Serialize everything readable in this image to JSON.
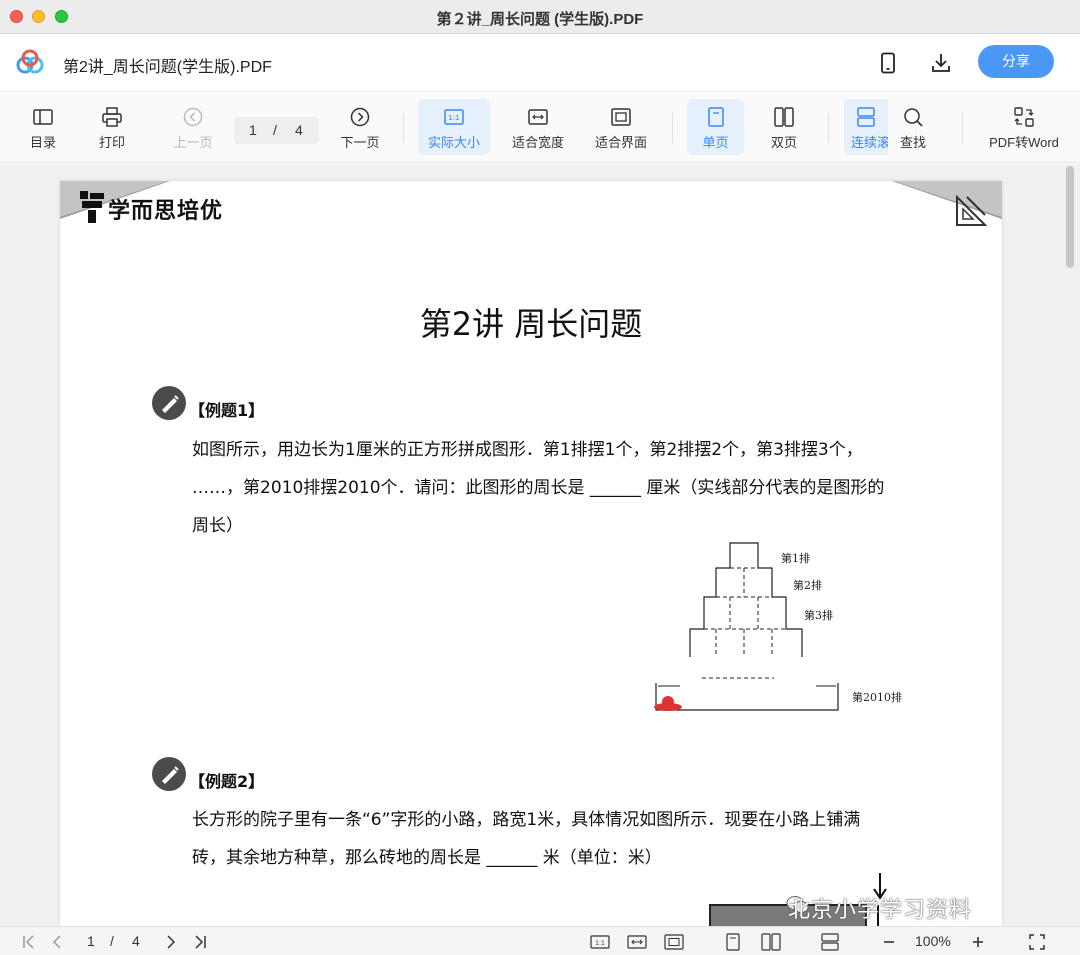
{
  "window": {
    "title": "第２讲_周长问题 (学生版).PDF"
  },
  "header": {
    "doc_name": "第2讲_周长问题(学生版).PDF",
    "share_label": "分享"
  },
  "toolbar": {
    "toc": "目录",
    "print": "打印",
    "prev": "上一页",
    "page_current": "1",
    "page_sep": "/",
    "page_total": "4",
    "next": "下一页",
    "actual_size": "实际大小",
    "fit_width": "适合宽度",
    "fit_page": "适合界面",
    "single": "单页",
    "double": "双页",
    "continuous": "连续滚",
    "find": "查找",
    "to_word": "PDF转Word"
  },
  "document": {
    "brand": "学而思培优",
    "title": "第2讲 周长问题",
    "example1": {
      "label": "【例题1】",
      "line1": "如图所示，用边长为1厘米的正方形拼成图形．第1排摆1个，第2排摆2个，第3排摆3个，",
      "line2": "……，第2010排摆2010个．请问：此图形的周长是 ______ 厘米（实线部分代表的是图形的",
      "line3": "周长）",
      "row1": "第1排",
      "row2": "第2排",
      "row3": "第3排",
      "row2010": "第2010排"
    },
    "example2": {
      "label": "【例题2】",
      "line1": "长方形的院子里有一条“6”字形的小路，路宽1米，具体情况如图所示．现要在小路上铺满",
      "line2": "砖，其余地方种草，那么砖地的周长是 ______ 米（单位：米）"
    },
    "watermark": "北京小学学习资料"
  },
  "bottom": {
    "page_current": "1",
    "page_sep": "/",
    "page_total": "4",
    "zoom": "100%"
  },
  "colors": {
    "accent": "#4a97f8",
    "active_bg": "#e6f0fd",
    "active_text": "#3b87ef"
  }
}
